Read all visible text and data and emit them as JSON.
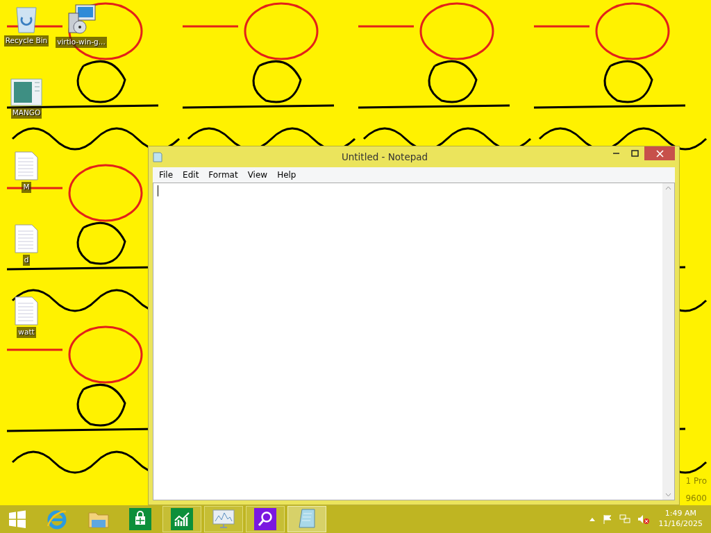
{
  "desktop_icons": [
    {
      "kind": "recycle",
      "label": "Recycle Bin"
    },
    {
      "kind": "installer",
      "label": "virtio-win-g..."
    },
    {
      "kind": "app",
      "label": "MANGO"
    },
    {
      "kind": "document",
      "label": "M"
    },
    {
      "kind": "document",
      "label": "d"
    },
    {
      "kind": "document",
      "label": "watt"
    }
  ],
  "watermark": [
    "1 Pro",
    "9600"
  ],
  "notepad": {
    "title": "Untitled - Notepad",
    "menu": [
      "File",
      "Edit",
      "Format",
      "View",
      "Help"
    ]
  },
  "taskbar": {
    "apps": [
      {
        "kind": "ie",
        "selected": false,
        "running": false
      },
      {
        "kind": "explorer",
        "selected": false,
        "running": false
      },
      {
        "kind": "store",
        "selected": false,
        "running": false
      },
      {
        "kind": "finance",
        "selected": false,
        "running": true
      },
      {
        "kind": "monitor",
        "selected": false,
        "running": true
      },
      {
        "kind": "search",
        "selected": false,
        "running": true
      },
      {
        "kind": "notepad",
        "selected": true,
        "running": true
      }
    ]
  },
  "clock": {
    "time": "1:49 AM",
    "date": "11/16/2025"
  }
}
